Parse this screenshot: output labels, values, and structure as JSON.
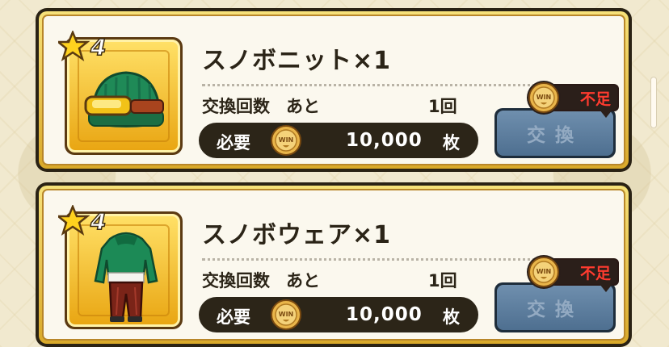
{
  "colors": {
    "insufficient_red": "#ff3b2f",
    "gold": "#e9a613",
    "exchange_disabled": "#4e6f90"
  },
  "items": [
    {
      "rarity": "4",
      "title": "スノボニット×1",
      "icon": "green-beanie-with-goggles-icon",
      "exchange_count_label": "交換回数",
      "remaining_label": "あと",
      "remaining_value": "1回",
      "cost_label": "必要",
      "cost_coin_text": "WIN",
      "cost_value": "10,000",
      "cost_unit": "枚",
      "exchange_button": "交換",
      "insufficient_text": "不足"
    },
    {
      "rarity": "4",
      "title": "スノボウェア×1",
      "icon": "snowboard-wear-outfit-icon",
      "exchange_count_label": "交換回数",
      "remaining_label": "あと",
      "remaining_value": "1回",
      "cost_label": "必要",
      "cost_coin_text": "WIN",
      "cost_value": "10,000",
      "cost_unit": "枚",
      "exchange_button": "交換",
      "insufficient_text": "不足"
    }
  ]
}
